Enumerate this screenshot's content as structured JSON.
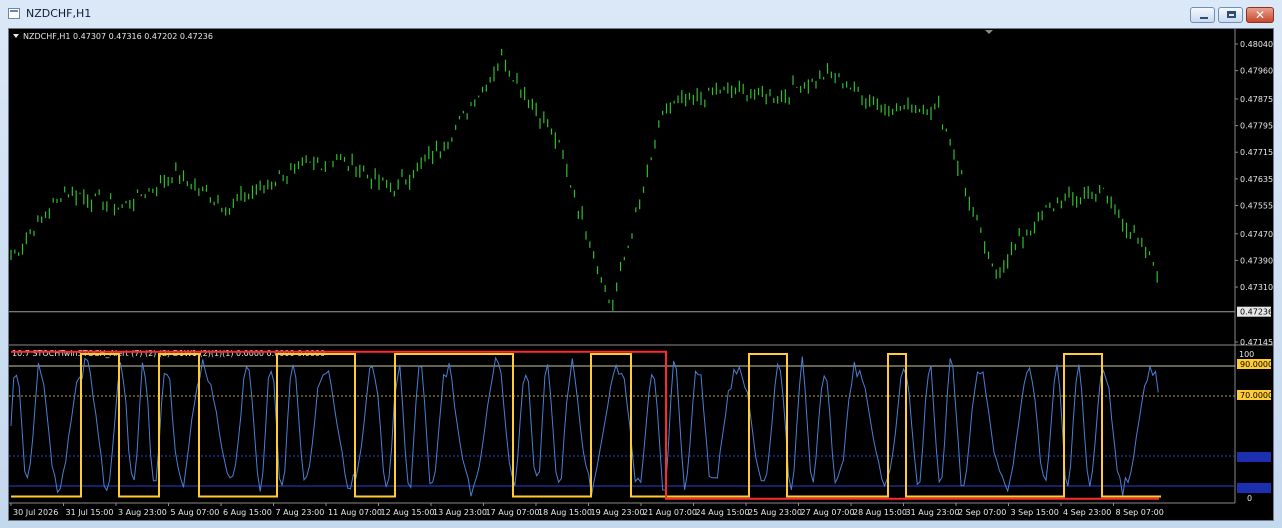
{
  "window": {
    "title": "NZDCHF,H1",
    "buttons": {
      "minimize": "minimize",
      "maximize": "maximize",
      "close": "✕"
    }
  },
  "colors": {
    "background": "#000000",
    "price_line": "#2fbf2f",
    "oscillator": "#4a7fd4",
    "mtf_yellow": "#ffcc33",
    "mtf_red": "#ff2a2a",
    "level_line": "#c8c8a0",
    "current_price_line": "#9aa0a0"
  },
  "main_chart": {
    "header": "NZDCHF,H1  0.47307 0.47316 0.47202 0.47236",
    "price_ticks": [
      "0.48040",
      "0.47960",
      "0.47875",
      "0.47795",
      "0.47715",
      "0.47635",
      "0.47555",
      "0.47470",
      "0.47390",
      "0.47310",
      "0.47145"
    ],
    "current_price": "0.47236"
  },
  "indicator": {
    "header": "10.7 STOCHTwinSTOCH_Alert (7) (2) (2) D1W1  (2)(1)(1) 0.0000 0.0000 0.0000",
    "levels": [
      "100",
      "90.0000",
      "70.0000",
      "0"
    ],
    "level_values": [
      90,
      70,
      30,
      10
    ]
  },
  "time_axis": [
    "30 Jul 2026",
    "31 Jul 15:00",
    "3 Aug 23:00",
    "5 Aug 07:00",
    "6 Aug 15:00",
    "7 Aug 23:00",
    "11 Aug 07:00",
    "12 Aug 15:00",
    "13 Aug 23:00",
    "17 Aug 07:00",
    "18 Aug 15:00",
    "19 Aug 23:00",
    "21 Aug 07:00",
    "24 Aug 15:00",
    "25 Aug 23:00",
    "27 Aug 07:00",
    "28 Aug 15:00",
    "31 Aug 23:00",
    "2 Sep 07:00",
    "3 Sep 15:00",
    "4 Sep 23:00",
    "8 Sep 07:00"
  ],
  "chart_data": {
    "type": "line",
    "title": "NZDCHF,H1",
    "series": [
      {
        "name": "NZDCHF,H1",
        "x": [
          "30 Jul 2026",
          "31 Jul 15:00",
          "3 Aug 23:00",
          "5 Aug 07:00",
          "6 Aug 15:00",
          "7 Aug 23:00",
          "11 Aug 07:00",
          "12 Aug 15:00",
          "13 Aug 23:00",
          "17 Aug 07:00",
          "18 Aug 15:00",
          "19 Aug 23:00",
          "21 Aug 07:00",
          "24 Aug 15:00",
          "25 Aug 23:00",
          "27 Aug 07:00",
          "28 Aug 15:00",
          "31 Aug 23:00",
          "2 Sep 07:00",
          "3 Sep 15:00",
          "4 Sep 23:00",
          "8 Sep 07:00"
        ],
        "values": [
          0.474,
          0.476,
          0.4755,
          0.4765,
          0.4755,
          0.4765,
          0.477,
          0.476,
          0.4775,
          0.48,
          0.4775,
          0.4725,
          0.4785,
          0.479,
          0.4788,
          0.4795,
          0.4785,
          0.4785,
          0.4735,
          0.4755,
          0.476,
          0.4736
        ]
      }
    ],
    "ylim": [
      0.47145,
      0.4804
    ],
    "xlabel": "",
    "ylabel": ""
  }
}
